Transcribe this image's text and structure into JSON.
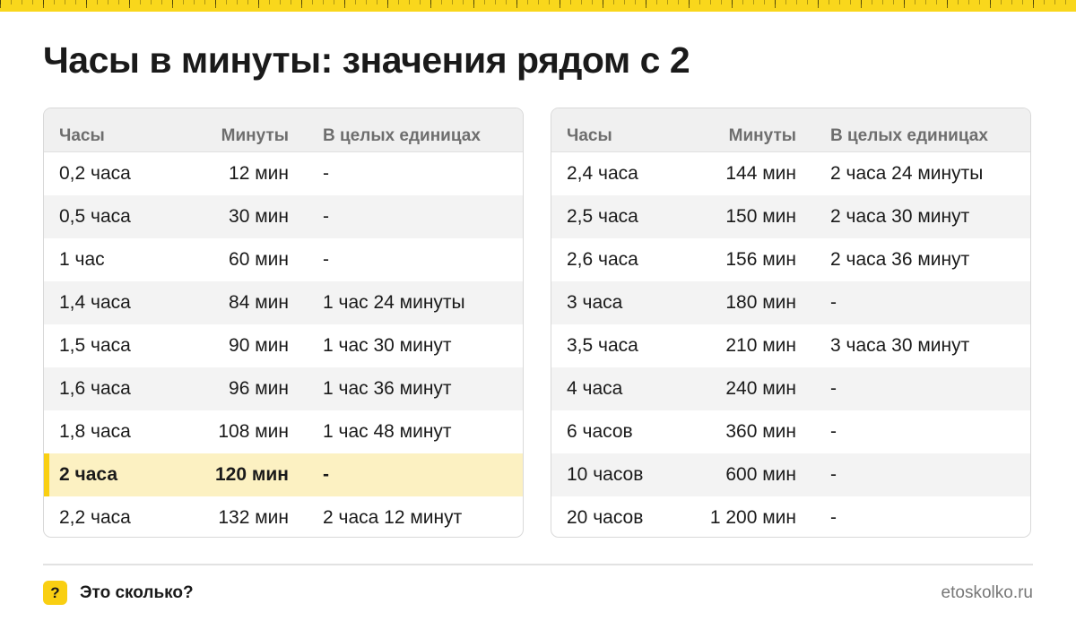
{
  "title": "Часы в минуты: значения рядом с 2",
  "columns": [
    "Часы",
    "Минуты",
    "В целых единицах"
  ],
  "left_table": [
    {
      "hours": "0,2 часа",
      "minutes": "12 мин",
      "units": "-"
    },
    {
      "hours": "0,5 часа",
      "minutes": "30 мин",
      "units": "-"
    },
    {
      "hours": "1 час",
      "minutes": "60 мин",
      "units": "-"
    },
    {
      "hours": "1,4 часа",
      "minutes": "84 мин",
      "units": "1 час 24 минуты"
    },
    {
      "hours": "1,5 часа",
      "minutes": "90 мин",
      "units": "1 час 30 минут"
    },
    {
      "hours": "1,6 часа",
      "minutes": "96 мин",
      "units": "1 час 36 минут"
    },
    {
      "hours": "1,8 часа",
      "minutes": "108 мин",
      "units": "1 час 48 минут"
    },
    {
      "hours": "2 часа",
      "minutes": "120 мин",
      "units": "-",
      "highlighted": true
    },
    {
      "hours": "2,2 часа",
      "minutes": "132 мин",
      "units": "2 часа 12 минут"
    }
  ],
  "right_table": [
    {
      "hours": "2,4 часа",
      "minutes": "144 мин",
      "units": "2 часа 24 минуты"
    },
    {
      "hours": "2,5 часа",
      "minutes": "150 мин",
      "units": "2 часа 30 минут"
    },
    {
      "hours": "2,6 часа",
      "minutes": "156 мин",
      "units": "2 часа 36 минут"
    },
    {
      "hours": "3 часа",
      "minutes": "180 мин",
      "units": "-"
    },
    {
      "hours": "3,5 часа",
      "minutes": "210 мин",
      "units": "3 часа 30 минут"
    },
    {
      "hours": "4 часа",
      "minutes": "240 мин",
      "units": "-"
    },
    {
      "hours": "6 часов",
      "minutes": "360 мин",
      "units": "-"
    },
    {
      "hours": "10 часов",
      "minutes": "600 мин",
      "units": "-"
    },
    {
      "hours": "20 часов",
      "minutes": "1 200 мин",
      "units": "-"
    }
  ],
  "footer": {
    "logo_glyph": "?",
    "brand": "Это сколько?",
    "site": "etoskolko.ru"
  },
  "colors": {
    "accent": "#f9cf12",
    "highlight_row": "#fcf1c2",
    "alt_row": "#f3f3f3"
  }
}
